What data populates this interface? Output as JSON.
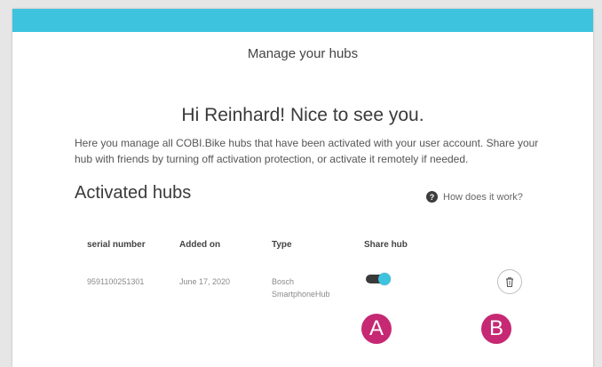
{
  "header": {
    "title": "Manage your hubs"
  },
  "greeting": "Hi Reinhard! Nice to see you.",
  "intro": "Here you manage all COBI.Bike hubs that have been activated with your user account. Share your hub with friends by turning off activation protection, or activate it remotely if needed.",
  "section": {
    "title": "Activated hubs",
    "help_label": "How does it work?",
    "help_icon": "question-icon"
  },
  "table": {
    "columns": [
      "serial number",
      "Added on",
      "Type",
      "Share hub"
    ],
    "rows": [
      {
        "serial": "9591100251301",
        "added_on": "June 17, 2020",
        "type_line1": "Bosch",
        "type_line2": "SmartphoneHub",
        "share_enabled": true
      }
    ]
  },
  "markers": {
    "a": "A",
    "b": "B"
  },
  "colors": {
    "accent": "#3ec3df",
    "marker": "#c62873",
    "toggle_track": "#3a3a3a"
  }
}
